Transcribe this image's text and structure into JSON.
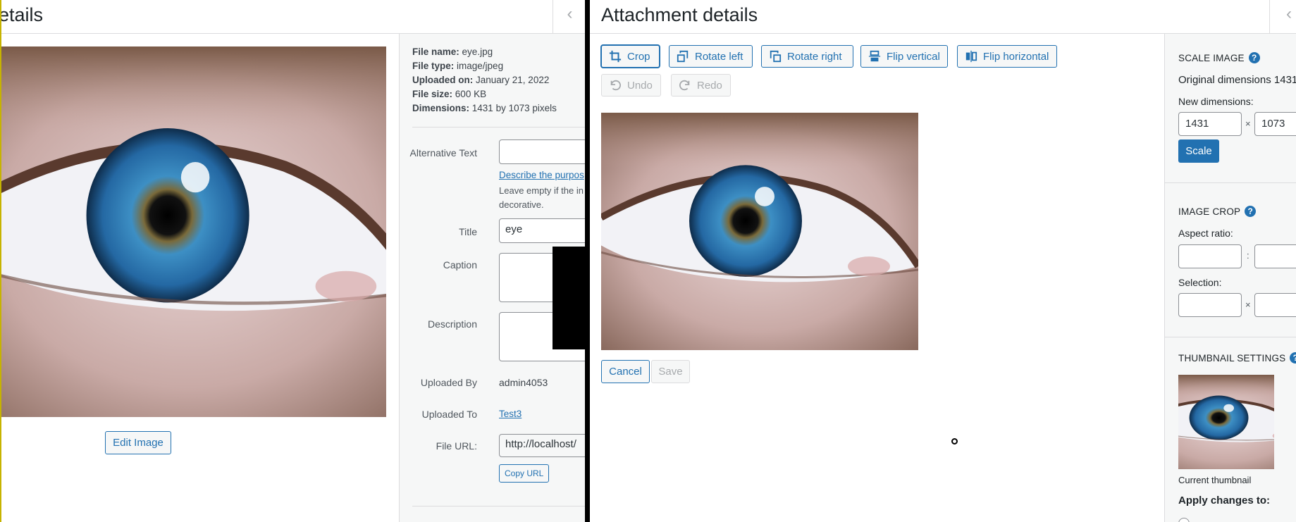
{
  "left": {
    "title": "etails",
    "details": {
      "file_name_label": "File name:",
      "file_name": "eye.jpg",
      "file_type_label": "File type:",
      "file_type": "image/jpeg",
      "uploaded_on_label": "Uploaded on:",
      "uploaded_on": "January 21, 2022",
      "file_size_label": "File size:",
      "file_size": "600 KB",
      "dimensions_label": "Dimensions:",
      "dimensions": "1431 by 1073 pixels"
    },
    "edit_image_label": "Edit Image",
    "form": {
      "alt_text_label": "Alternative Text",
      "alt_text_value": "",
      "describe_link": "Describe the purpos",
      "leave_empty_line1": "Leave empty if the in",
      "leave_empty_line2": "decorative.",
      "title_label": "Title",
      "title_value": "eye",
      "caption_label": "Caption",
      "description_label": "Description",
      "uploaded_by_label": "Uploaded By",
      "uploaded_by": "admin4053",
      "uploaded_to_label": "Uploaded To",
      "uploaded_to": "Test3",
      "file_url_label": "File URL:",
      "file_url": "http://localhost/",
      "copy_url_label": "Copy URL"
    }
  },
  "right": {
    "title": "Attachment details",
    "toolbar": {
      "crop": "Crop",
      "rotate_left": "Rotate left",
      "rotate_right": "Rotate right",
      "flip_vertical": "Flip vertical",
      "flip_horizontal": "Flip horizontal",
      "undo": "Undo",
      "redo": "Redo"
    },
    "cancel_label": "Cancel",
    "save_label": "Save",
    "sidebar": {
      "scale_title": "Scale Image",
      "original_dimensions": "Original dimensions 1431",
      "new_dimensions_label": "New dimensions:",
      "width_value": "1431",
      "times": "×",
      "height_value": "1073",
      "scale_button": "Scale",
      "crop_title": "Image Crop",
      "aspect_ratio_label": "Aspect ratio:",
      "colon": ":",
      "selection_label": "Selection:",
      "thumb_title": "Thumbnail Settings",
      "current_thumbnail": "Current thumbnail",
      "apply_changes": "Apply changes to:",
      "help_glyph": "?"
    }
  },
  "colors": {
    "accent": "#2271b1",
    "panel_bg": "#f6f7f7",
    "border": "#dcdcde"
  },
  "icons": [
    "chevron-left-icon",
    "crop-icon",
    "rotate-left-icon",
    "rotate-right-icon",
    "flip-vertical-icon",
    "flip-horizontal-icon",
    "undo-icon",
    "redo-icon",
    "help-icon"
  ]
}
